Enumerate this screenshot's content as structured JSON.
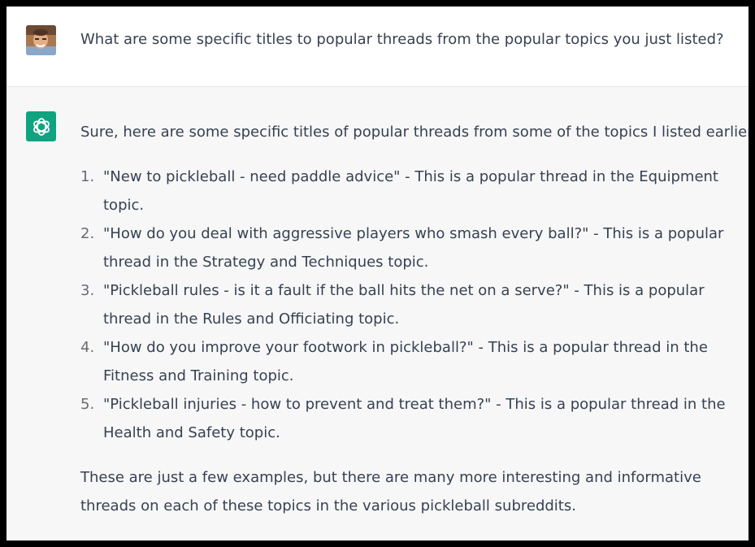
{
  "user_message": {
    "avatar": "user-avatar-photo",
    "text": "What are some specific titles to popular threads from the popular topics you just listed?"
  },
  "assistant_message": {
    "avatar": "chatgpt-logo-icon",
    "accent_color": "#10a37f",
    "intro": "Sure, here are some specific titles of popular threads from some of the topics I listed earlier:",
    "items": [
      {
        "number": "1.",
        "text": "\"New to pickleball - need paddle advice\" - This is a popular thread in the Equipment topic."
      },
      {
        "number": "2.",
        "text": "\"How do you deal with aggressive players who smash every ball?\" - This is a popular thread in the Strategy and Techniques topic."
      },
      {
        "number": "3.",
        "text": "\"Pickleball rules - is it a fault if the ball hits the net on a serve?\" - This is a popular thread in the Rules and Officiating topic."
      },
      {
        "number": "4.",
        "text": "\"How do you improve your footwork in pickleball?\" - This is a popular thread in the Fitness and Training topic."
      },
      {
        "number": "5.",
        "text": "\"Pickleball injuries - how to prevent and treat them?\" - This is a popular thread in the Health and Safety topic."
      }
    ],
    "outro": "These are just a few examples, but there are many more interesting and informative threads on each of these topics in the various pickleball subreddits."
  }
}
